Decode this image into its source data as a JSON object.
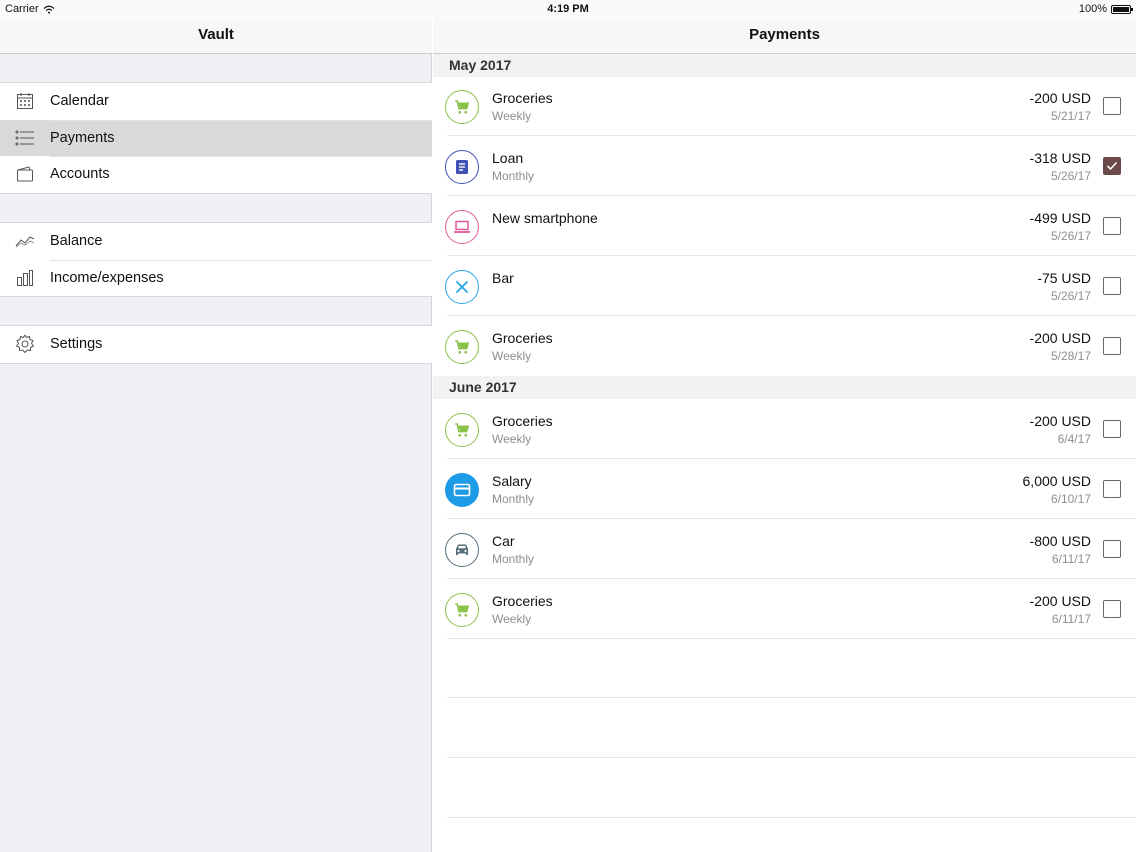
{
  "status_bar": {
    "carrier": "Carrier",
    "time": "4:19 PM",
    "battery": "100%"
  },
  "sidebar": {
    "title": "Vault",
    "groups": [
      {
        "items": [
          {
            "label": "Calendar",
            "icon": "calendar-icon",
            "selected": false
          },
          {
            "label": "Payments",
            "icon": "list-icon",
            "selected": true
          },
          {
            "label": "Accounts",
            "icon": "wallet-icon",
            "selected": false
          }
        ]
      },
      {
        "items": [
          {
            "label": "Balance",
            "icon": "line-chart-icon",
            "selected": false
          },
          {
            "label": "Income/expenses",
            "icon": "bar-chart-icon",
            "selected": false
          }
        ]
      },
      {
        "items": [
          {
            "label": "Settings",
            "icon": "gear-icon",
            "selected": false
          }
        ]
      }
    ]
  },
  "main": {
    "title": "Payments",
    "sections": [
      {
        "header": "May 2017",
        "rows": [
          {
            "title": "Groceries",
            "subtitle": "Weekly",
            "amount": "-200 USD",
            "date": "5/21/17",
            "icon": "cart-icon",
            "color": "#8bc34a",
            "checked": false
          },
          {
            "title": "Loan",
            "subtitle": "Monthly",
            "amount": "-318 USD",
            "date": "5/26/17",
            "icon": "document-icon",
            "color": "#3f51b5",
            "checked": true
          },
          {
            "title": "New smartphone",
            "subtitle": "",
            "amount": "-499 USD",
            "date": "5/26/17",
            "icon": "laptop-icon",
            "color": "#e05a9a",
            "checked": false
          },
          {
            "title": "Bar",
            "subtitle": "",
            "amount": "-75 USD",
            "date": "5/26/17",
            "icon": "cutlery-icon",
            "color": "#29a3e8",
            "checked": false
          },
          {
            "title": "Groceries",
            "subtitle": "Weekly",
            "amount": "-200 USD",
            "date": "5/28/17",
            "icon": "cart-icon",
            "color": "#8bc34a",
            "checked": false
          }
        ]
      },
      {
        "header": "June 2017",
        "rows": [
          {
            "title": "Groceries",
            "subtitle": "Weekly",
            "amount": "-200 USD",
            "date": "6/4/17",
            "icon": "cart-icon",
            "color": "#8bc34a",
            "checked": false
          },
          {
            "title": "Salary",
            "subtitle": "Monthly",
            "amount": "6,000 USD",
            "date": "6/10/17",
            "icon": "card-icon",
            "color": "#1e9be6",
            "checked": false,
            "filled": true
          },
          {
            "title": "Car",
            "subtitle": "Monthly",
            "amount": "-800 USD",
            "date": "6/11/17",
            "icon": "car-icon",
            "color": "#546e7a",
            "checked": false
          },
          {
            "title": "Groceries",
            "subtitle": "Weekly",
            "amount": "-200 USD",
            "date": "6/11/17",
            "icon": "cart-icon",
            "color": "#8bc34a",
            "checked": false
          }
        ]
      }
    ]
  }
}
